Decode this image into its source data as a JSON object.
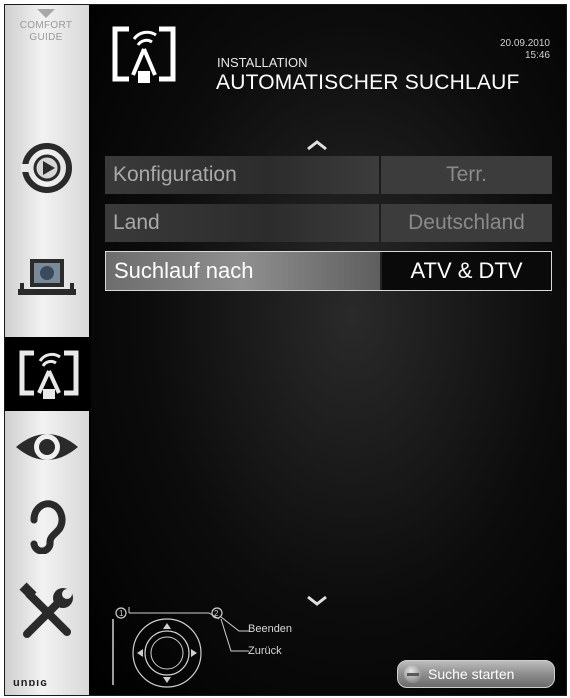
{
  "sidebar": {
    "comfort_guide": "COMFORT GUIDE",
    "brand": "unɒıɢ",
    "items": [
      {
        "icon": "source-icon"
      },
      {
        "icon": "tv-globe-icon"
      },
      {
        "icon": "installation-antenna-icon",
        "active": true
      },
      {
        "icon": "eye-icon"
      },
      {
        "icon": "ear-icon"
      },
      {
        "icon": "tools-icon"
      }
    ]
  },
  "header": {
    "subtitle": "INSTALLATION",
    "title": "AUTOMATISCHER SUCHLAUF",
    "date": "20.09.2010",
    "time": "15:46"
  },
  "settings": [
    {
      "label": "Konfiguration",
      "value": "Terr."
    },
    {
      "label": "Land",
      "value": "Deutschland"
    },
    {
      "label": "Suchlauf nach",
      "value": "ATV & DTV",
      "selected": true
    }
  ],
  "footer": {
    "exit_label": "Beenden",
    "back_label": "Zurück",
    "start_label": "Suche starten"
  },
  "colors": {
    "background": "#000000",
    "sidebar": "#e8e8e8",
    "row_normal": "#3a3a3a",
    "row_selected": "#8f8f8f",
    "start_button": "#9c9c9c"
  }
}
